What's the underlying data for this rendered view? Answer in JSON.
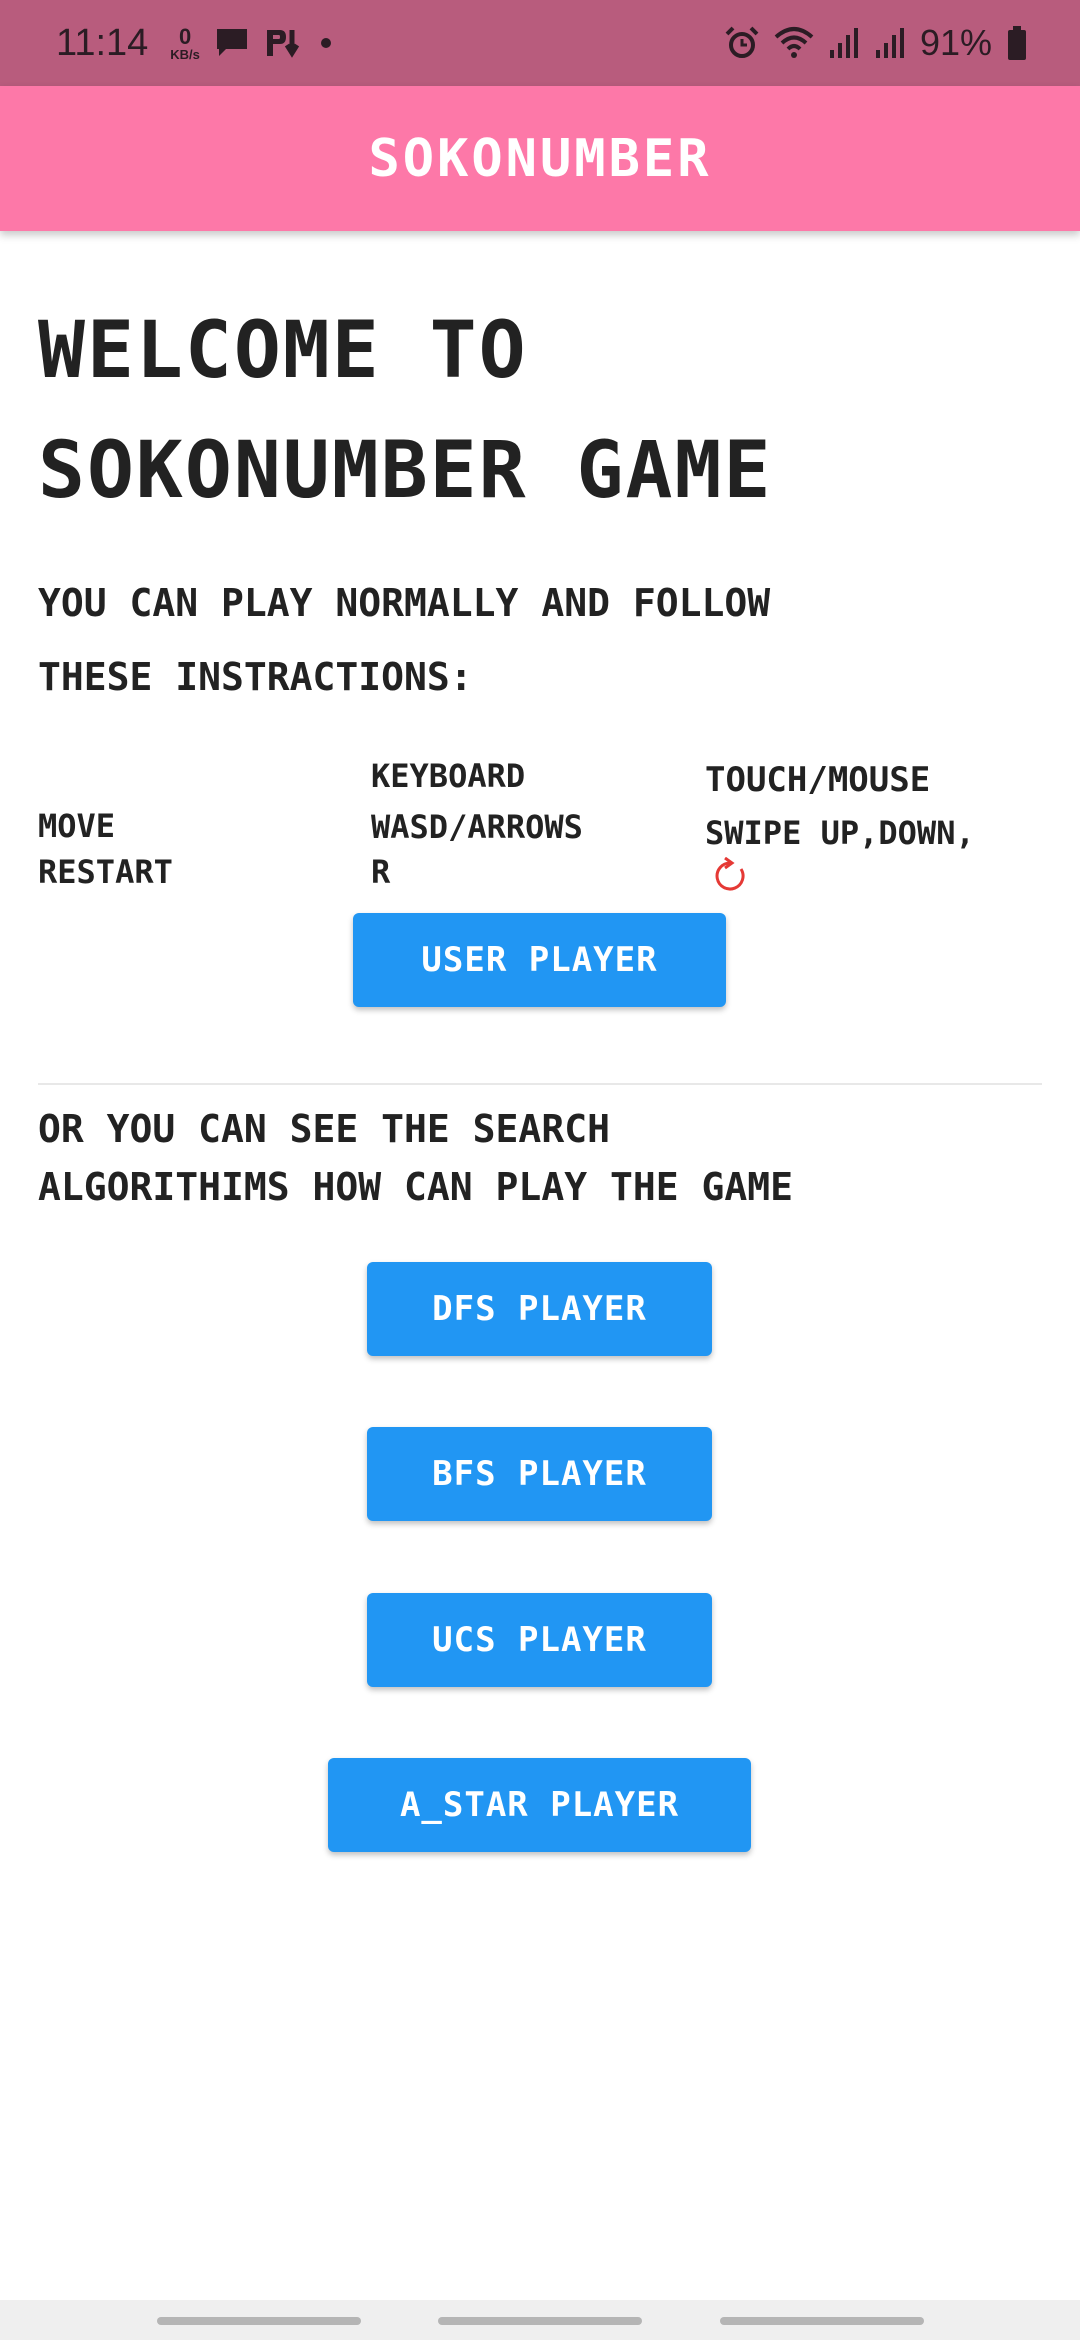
{
  "status_bar": {
    "time": "11:14",
    "net_speed_value": "0",
    "net_speed_unit": "KB/s",
    "battery": "91%",
    "icons": [
      "chat-icon",
      "pl-icon",
      "dot-icon",
      "alarm-icon",
      "wifi-icon",
      "signal-icon",
      "signal-icon",
      "battery-icon"
    ]
  },
  "app_bar": {
    "title": "SOKONUMBER"
  },
  "welcome": {
    "line1": "WELCOME TO",
    "line2": "SOKONUMBER GAME"
  },
  "intro": {
    "line1": "YOU CAN PLAY NORMALLY AND FOLLOW",
    "line2": "THESE INSTRACTIONS:"
  },
  "controls": {
    "header_keyboard": "KEYBOARD",
    "header_touch": "TOUCH/MOUSE",
    "rows": [
      {
        "action": "MOVE",
        "keyboard": "WASD/ARROWS",
        "touch": "SWIPE UP,DOWN,"
      },
      {
        "action": "RESTART",
        "keyboard": "R",
        "touch": ""
      }
    ]
  },
  "buttons": {
    "user": "USER PLAYER",
    "dfs": "DFS PLAYER",
    "bfs": "BFS PLAYER",
    "ucs": "UCS PLAYER",
    "astar": "A_STAR PLAYER"
  },
  "search_section": {
    "line1": "OR YOU CAN SEE THE SEARCH",
    "line2": "ALGORITHIMS HOW CAN PLAY THE GAME"
  },
  "colors": {
    "status_bar": "#b85c7d",
    "app_bar": "#fd78a8",
    "button": "#2196f3",
    "restart_icon": "#e53935"
  }
}
